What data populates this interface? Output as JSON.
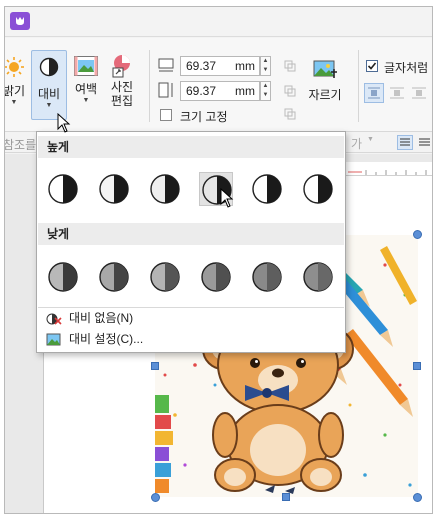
{
  "ribbon": {
    "brightness_label": "밝기",
    "contrast_label": "대비",
    "margin_label": "여백",
    "photo_edit_line1": "사진",
    "photo_edit_line2": "편집",
    "width_value": "69.37",
    "height_value": "69.37",
    "unit": "mm",
    "fix_size_label": "크기 고정",
    "crop_label": "자르기",
    "text_wrap_label": "글자처럼"
  },
  "row2": {
    "left_label": "참조를",
    "font_label": "가"
  },
  "popup": {
    "high_label": "높게",
    "low_label": "낮게",
    "high_swatches": [
      "contrast-high-1",
      "contrast-high-2",
      "contrast-high-3",
      "contrast-high-4",
      "contrast-high-5",
      "contrast-high-6"
    ],
    "low_swatches": [
      "contrast-low-1",
      "contrast-low-2",
      "contrast-low-3",
      "contrast-low-4",
      "contrast-low-5",
      "contrast-low-6"
    ],
    "no_contrast_label": "대비 없음(N)",
    "contrast_settings_label": "대비 설정(C)..."
  },
  "colors": {
    "accent": "#8a4fd6",
    "selected_button": "#dbe8f7",
    "handle": "#5b8fd6"
  }
}
